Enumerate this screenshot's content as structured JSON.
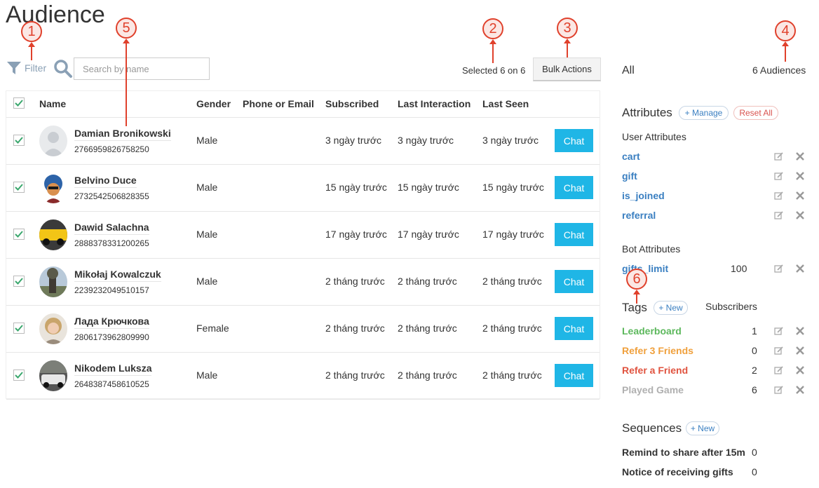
{
  "page_title": "Audience",
  "filter_label": "Filter",
  "search": {
    "placeholder": "Search by name"
  },
  "selection_text": "Selected 6 on 6",
  "bulk_actions_label": "Bulk Actions",
  "table": {
    "columns": [
      "Name",
      "Gender",
      "Phone or Email",
      "Subscribed",
      "Last Interaction",
      "Last Seen"
    ],
    "chat_label": "Chat",
    "rows": [
      {
        "name": "Damian Bronikowski",
        "id": "2766959826758250",
        "gender": "Male",
        "subscribed": "3 ngày trước",
        "last_interaction": "3 ngày trước",
        "last_seen": "3 ngày trước"
      },
      {
        "name": "Belvino Duce",
        "id": "2732542506828355",
        "gender": "Male",
        "subscribed": "15 ngày trước",
        "last_interaction": "15 ngày trước",
        "last_seen": "15 ngày trước"
      },
      {
        "name": "Dawid Salachna",
        "id": "2888378331200265",
        "gender": "Male",
        "subscribed": "17 ngày trước",
        "last_interaction": "17 ngày trước",
        "last_seen": "17 ngày trước"
      },
      {
        "name": "Mikołaj Kowalczuk",
        "id": "2239232049510157",
        "gender": "Male",
        "subscribed": "2 tháng trước",
        "last_interaction": "2 tháng trước",
        "last_seen": "2 tháng trước"
      },
      {
        "name": "Лада Крючкова",
        "id": "2806173962809990",
        "gender": "Female",
        "subscribed": "2 tháng trước",
        "last_interaction": "2 tháng trước",
        "last_seen": "2 tháng trước"
      },
      {
        "name": "Nikodem Luksza",
        "id": "2648387458610525",
        "gender": "Male",
        "subscribed": "2 tháng trước",
        "last_interaction": "2 tháng trước",
        "last_seen": "2 tháng trước"
      }
    ]
  },
  "sidebar": {
    "all_label": "All",
    "audiences_count": "6 Audiences",
    "attributes": {
      "title": "Attributes",
      "manage_label": "+ Manage",
      "reset_label": "Reset All",
      "user_title": "User Attributes",
      "user_items": [
        "cart",
        "gift",
        "is_joined",
        "referral"
      ],
      "bot_title": "Bot Attributes",
      "bot_items": [
        {
          "name": "gifts_limit",
          "value": "100"
        }
      ]
    },
    "tags": {
      "title": "Tags",
      "new_label": "+ New",
      "subscribers_label": "Subscribers",
      "items": [
        {
          "name": "Leaderboard",
          "count": "1",
          "color": "#5cb85c"
        },
        {
          "name": "Refer 3 Friends",
          "count": "0",
          "color": "#f0a03c"
        },
        {
          "name": "Refer a Friend",
          "count": "2",
          "color": "#e0533f"
        },
        {
          "name": "Played Game",
          "count": "6",
          "color": "#b0b0b0"
        }
      ]
    },
    "sequences": {
      "title": "Sequences",
      "new_label": "+ New",
      "items": [
        {
          "name": "Remind to share after 15m",
          "count": "0"
        },
        {
          "name": "Notice of receiving gifts",
          "count": "0"
        }
      ]
    }
  },
  "annotations": [
    "1",
    "2",
    "3",
    "4",
    "5",
    "6"
  ],
  "colors": {
    "accent": "#1fb6e6",
    "checkbox": "#3aa76d",
    "link": "#3a7fc1",
    "annotation": "#e0412c"
  }
}
